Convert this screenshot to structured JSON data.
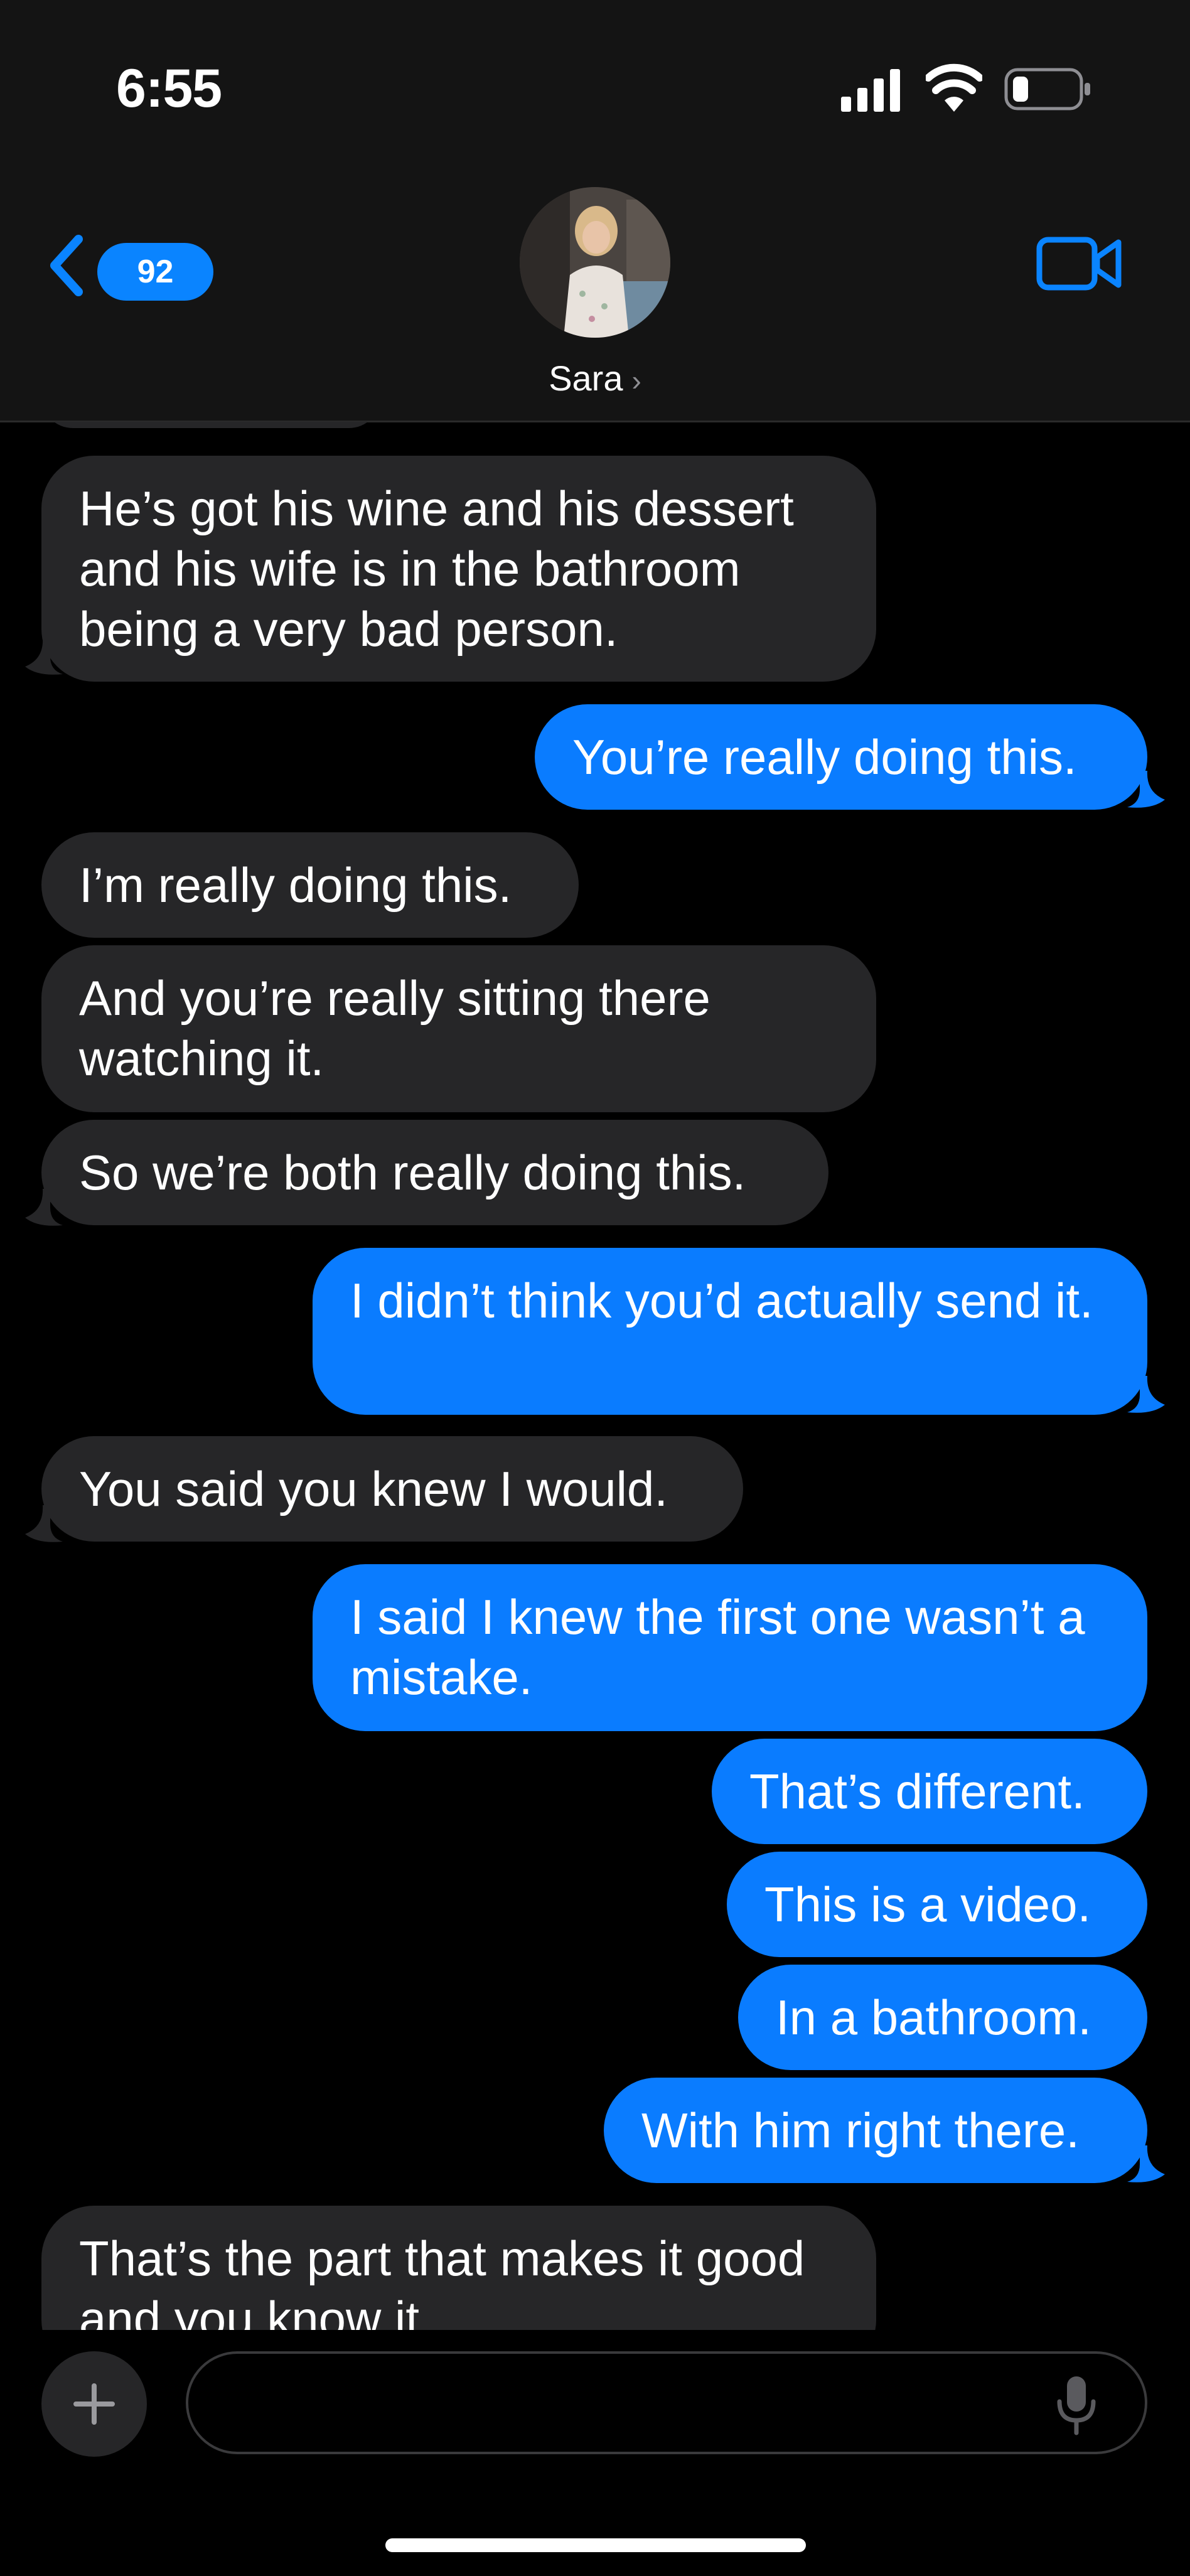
{
  "status_bar": {
    "time": "6:55"
  },
  "header": {
    "back_badge": "92",
    "contact_name": "Sara",
    "chevron": "›"
  },
  "messages": [
    {
      "from": "them",
      "text": "He’s got his wine and his dessert and his wife is in the bathroom being a very bad person."
    },
    {
      "from": "me",
      "text": "You’re really doing this."
    },
    {
      "from": "them",
      "text": "I’m really doing this."
    },
    {
      "from": "them",
      "text": "And you’re really sitting there watching it."
    },
    {
      "from": "them",
      "text": "So we’re both really doing this."
    },
    {
      "from": "me",
      "text": "I didn’t think you’d actually send it."
    },
    {
      "from": "them",
      "text": "You said you knew I would."
    },
    {
      "from": "me",
      "text": "I said I knew the first one wasn’t a mistake."
    },
    {
      "from": "me",
      "text": "That’s different."
    },
    {
      "from": "me",
      "text": "This is a video."
    },
    {
      "from": "me",
      "text": "In a bathroom."
    },
    {
      "from": "me",
      "text": "With him right there."
    },
    {
      "from": "them",
      "text": "That’s the part that makes it good and you know it."
    }
  ],
  "composer": {
    "placeholder": ""
  },
  "icons": {
    "back": "chevron-left-icon",
    "video": "video-camera-icon",
    "add": "plus-icon",
    "mic": "microphone-icon"
  },
  "colors": {
    "outgoing": "#0a7cff",
    "incoming": "#262628",
    "accent": "#0a84ff",
    "background": "#000000"
  }
}
